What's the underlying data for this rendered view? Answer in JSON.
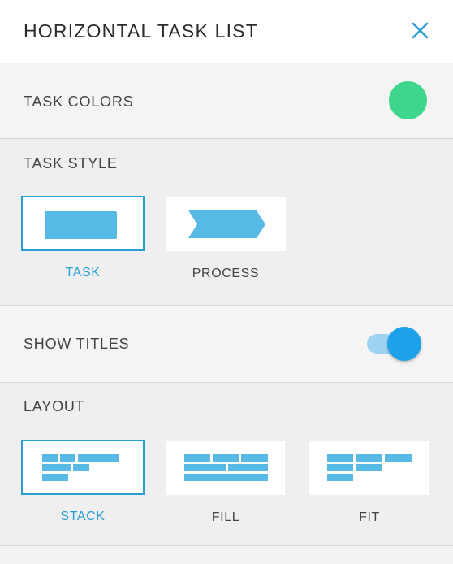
{
  "header": {
    "title": "HORIZONTAL TASK LIST",
    "close_icon": "close-icon"
  },
  "task_colors": {
    "label": "TASK COLORS",
    "color": "#3dd68c"
  },
  "task_style": {
    "label": "TASK STYLE",
    "options": [
      {
        "label": "TASK",
        "icon": "task-rectangle-icon",
        "selected": true
      },
      {
        "label": "PROCESS",
        "icon": "process-chevron-icon",
        "selected": false
      }
    ]
  },
  "show_titles": {
    "label": "SHOW TITLES",
    "enabled": true
  },
  "layout": {
    "label": "LAYOUT",
    "options": [
      {
        "label": "STACK",
        "icon": "layout-stack-icon",
        "selected": true
      },
      {
        "label": "FILL",
        "icon": "layout-fill-icon",
        "selected": false
      },
      {
        "label": "FIT",
        "icon": "layout-fit-icon",
        "selected": false
      }
    ]
  },
  "colors": {
    "accent": "#2a9fd6",
    "shape": "#56b9e6",
    "toggle_track": "#9fd3f2",
    "toggle_knob": "#1da1e8"
  }
}
